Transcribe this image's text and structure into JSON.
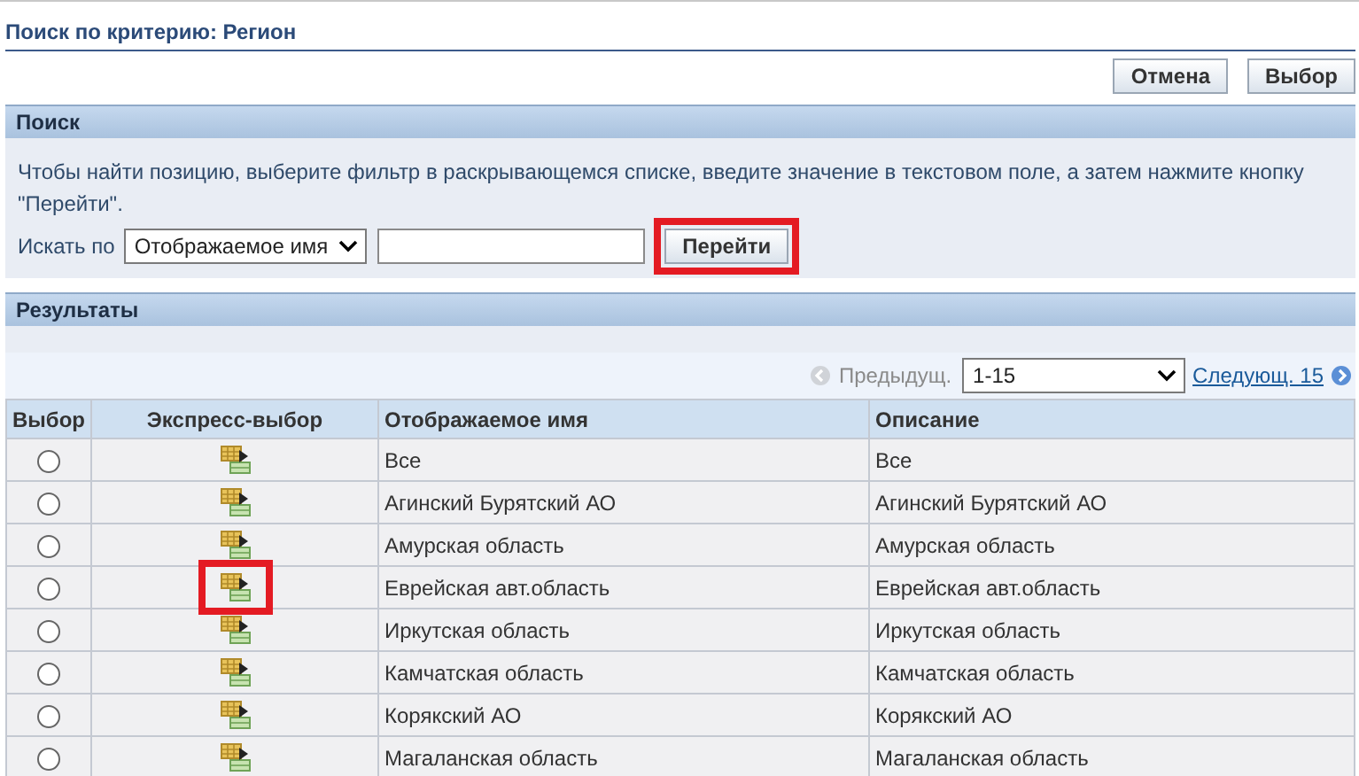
{
  "page_title": "Поиск по критерию: Регион",
  "buttons": [
    {
      "label": "Отмена"
    },
    {
      "label": "Выбор"
    }
  ],
  "search": {
    "header": "Поиск",
    "instructions": "Чтобы найти позицию, выберите фильтр в раскрывающемся списке, введите значение в текстовом поле, а затем нажмите кнопку \"Перейти\".",
    "search_by_label": "Искать по",
    "filter_value": "Отображаемое имя",
    "go_button": {
      "label": "Перейти",
      "highlighted": true
    }
  },
  "results": {
    "header": "Результаты",
    "pagination": {
      "previous": "Предыдущ.",
      "range": "1-15",
      "next": "Следующ. 15"
    },
    "columns": [
      "Выбор",
      "Экспресс-выбор",
      "Отображаемое имя",
      "Описание"
    ],
    "rows": [
      {
        "selected": false,
        "highlighted": false,
        "name": "Все",
        "description": "Все"
      },
      {
        "selected": false,
        "highlighted": false,
        "name": "Агинский Бурятский АО",
        "description": "Агинский Бурятский АО"
      },
      {
        "selected": false,
        "highlighted": false,
        "name": "Амурская область",
        "description": "Амурская область"
      },
      {
        "selected": false,
        "highlighted": true,
        "name": "Еврейская авт.область",
        "description": "Еврейская авт.область"
      },
      {
        "selected": false,
        "highlighted": false,
        "name": "Иркутская область",
        "description": "Иркутская область"
      },
      {
        "selected": false,
        "highlighted": false,
        "name": "Камчатская область",
        "description": "Камчатская область"
      },
      {
        "selected": false,
        "highlighted": false,
        "name": "Корякский АО",
        "description": "Корякский АО"
      },
      {
        "selected": false,
        "highlighted": false,
        "name": "Магаланская область",
        "description": "Магаланская область"
      }
    ]
  }
}
